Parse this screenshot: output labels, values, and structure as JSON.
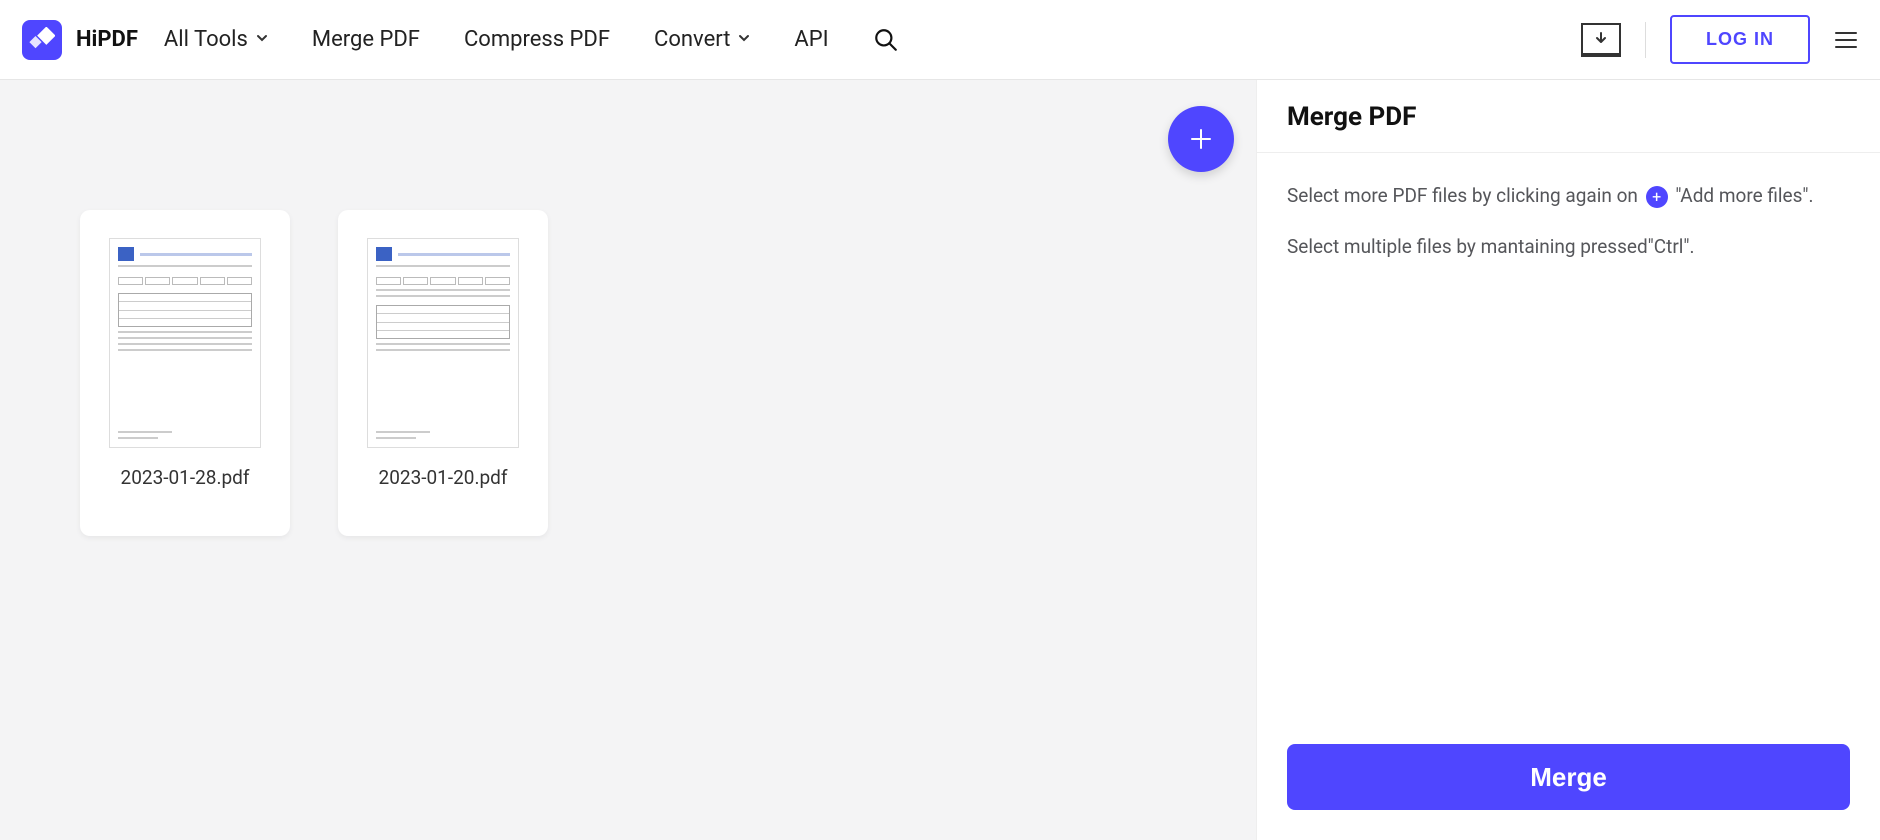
{
  "brand": "HiPDF",
  "nav": {
    "all_tools": "All Tools",
    "merge_pdf": "Merge PDF",
    "compress_pdf": "Compress PDF",
    "convert": "Convert",
    "api": "API"
  },
  "header": {
    "login": "LOG IN"
  },
  "files": [
    {
      "name": "2023-01-28.pdf"
    },
    {
      "name": "2023-01-20.pdf"
    }
  ],
  "sidebar": {
    "title": "Merge PDF",
    "instr1a": "Select more PDF files by clicking again on ",
    "instr1b": " \"Add more files\".",
    "instr2": "Select multiple files by mantaining pressed\"Ctrl\".",
    "merge_button": "Merge"
  },
  "colors": {
    "accent": "#4f46ff"
  }
}
